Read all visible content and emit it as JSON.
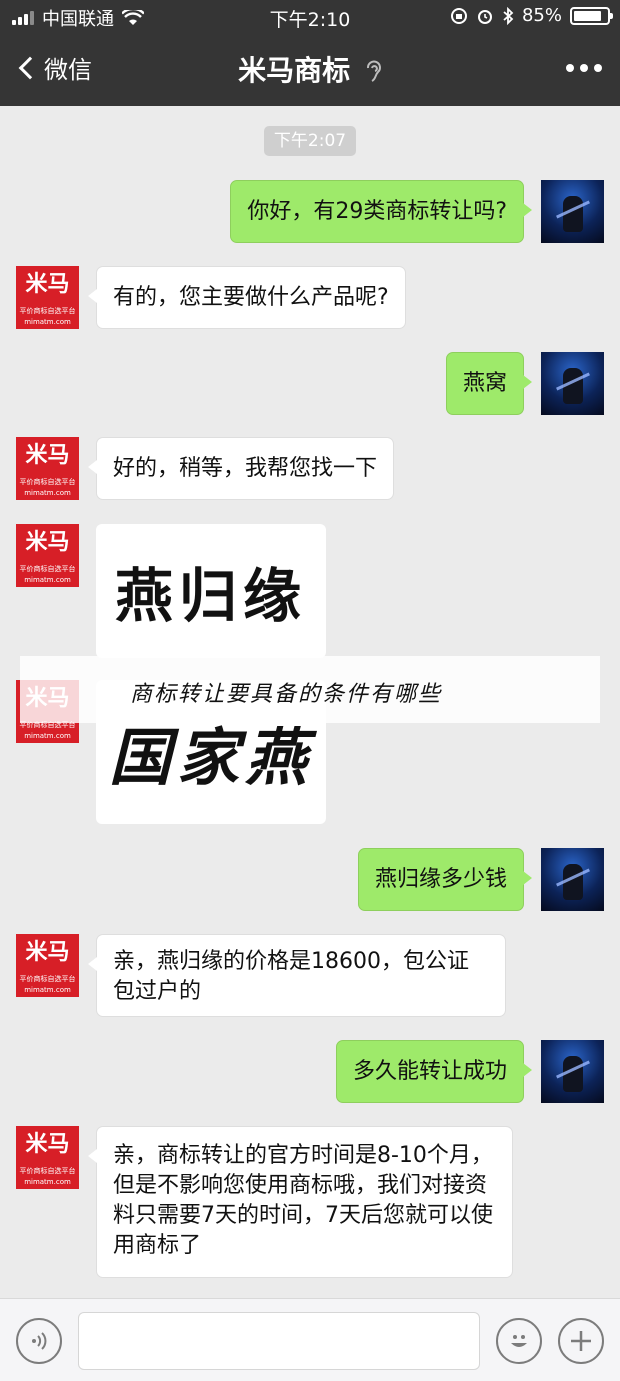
{
  "status_bar": {
    "carrier": "中国联通",
    "time": "下午2:10",
    "battery": "85%",
    "battery_level": 0.85
  },
  "nav": {
    "back_label": "微信",
    "title": "米马商标"
  },
  "chat": {
    "timestamp": "下午2:07",
    "shop_avatar_brand": "米马",
    "shop_avatar_sub": "平价商标自选平台 mimatm.com",
    "messages": [
      {
        "from": "me",
        "text": "你好，有29类商标转让吗?"
      },
      {
        "from": "other",
        "text": "有的，您主要做什么产品呢?"
      },
      {
        "from": "me",
        "text": "燕窝"
      },
      {
        "from": "other",
        "text": "好的，稍等，我帮您找一下"
      },
      {
        "from": "other",
        "type": "image",
        "image_text": "燕归缘"
      },
      {
        "from": "other",
        "type": "image",
        "image_text": "国家燕"
      },
      {
        "from": "me",
        "text": "燕归缘多少钱"
      },
      {
        "from": "other",
        "text": "亲，燕归缘的价格是18600，包公证包过户的"
      },
      {
        "from": "me",
        "text": "多久能转让成功"
      },
      {
        "from": "other",
        "text": "亲，商标转让的官方时间是8-10个月，但是不影响您使用商标哦，我们对接资料只需要7天的时间，7天后您就可以使用商标了"
      }
    ]
  },
  "overlay_caption": "商标转让要具备的条件有哪些",
  "input_bar": {
    "text": ""
  },
  "icons": {
    "signal": "signal-icon",
    "wifi": "wifi-icon",
    "battery": "battery-icon",
    "ear": "ear-icon",
    "more": "more-icon",
    "voice": "voice-icon",
    "emoji": "emoji-icon",
    "plus": "plus-icon"
  },
  "colors": {
    "topbar": "#353535",
    "my_bubble": "#9eea6a",
    "background": "#ebebeb",
    "shop_red": "#d71f27"
  }
}
